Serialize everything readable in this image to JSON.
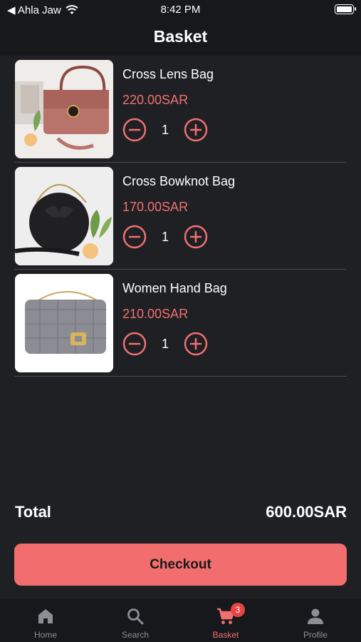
{
  "status_bar": {
    "carrier": "◀ Ahla Jaw",
    "time": "8:42 PM"
  },
  "header": {
    "title": "Basket"
  },
  "items": [
    {
      "name": "Cross Lens Bag",
      "price": "220.00SAR",
      "quantity": "1"
    },
    {
      "name": "Cross Bowknot Bag",
      "price": "170.00SAR",
      "quantity": "1"
    },
    {
      "name": "Women Hand Bag",
      "price": "210.00SAR",
      "quantity": "1"
    }
  ],
  "summary": {
    "total_label": "Total",
    "total_value": "600.00SAR"
  },
  "checkout_label": "Checkout",
  "tabs": [
    {
      "label": "Home",
      "icon": "home-icon"
    },
    {
      "label": "Search",
      "icon": "search-icon"
    },
    {
      "label": "Basket",
      "icon": "cart-icon",
      "badge": "3",
      "active": true
    },
    {
      "label": "Profile",
      "icon": "profile-icon"
    }
  ],
  "colors": {
    "accent": "#f07070",
    "button": "#f26e6e",
    "background": "#1f2024",
    "bar": "#17181b",
    "badge": "#e84545"
  }
}
